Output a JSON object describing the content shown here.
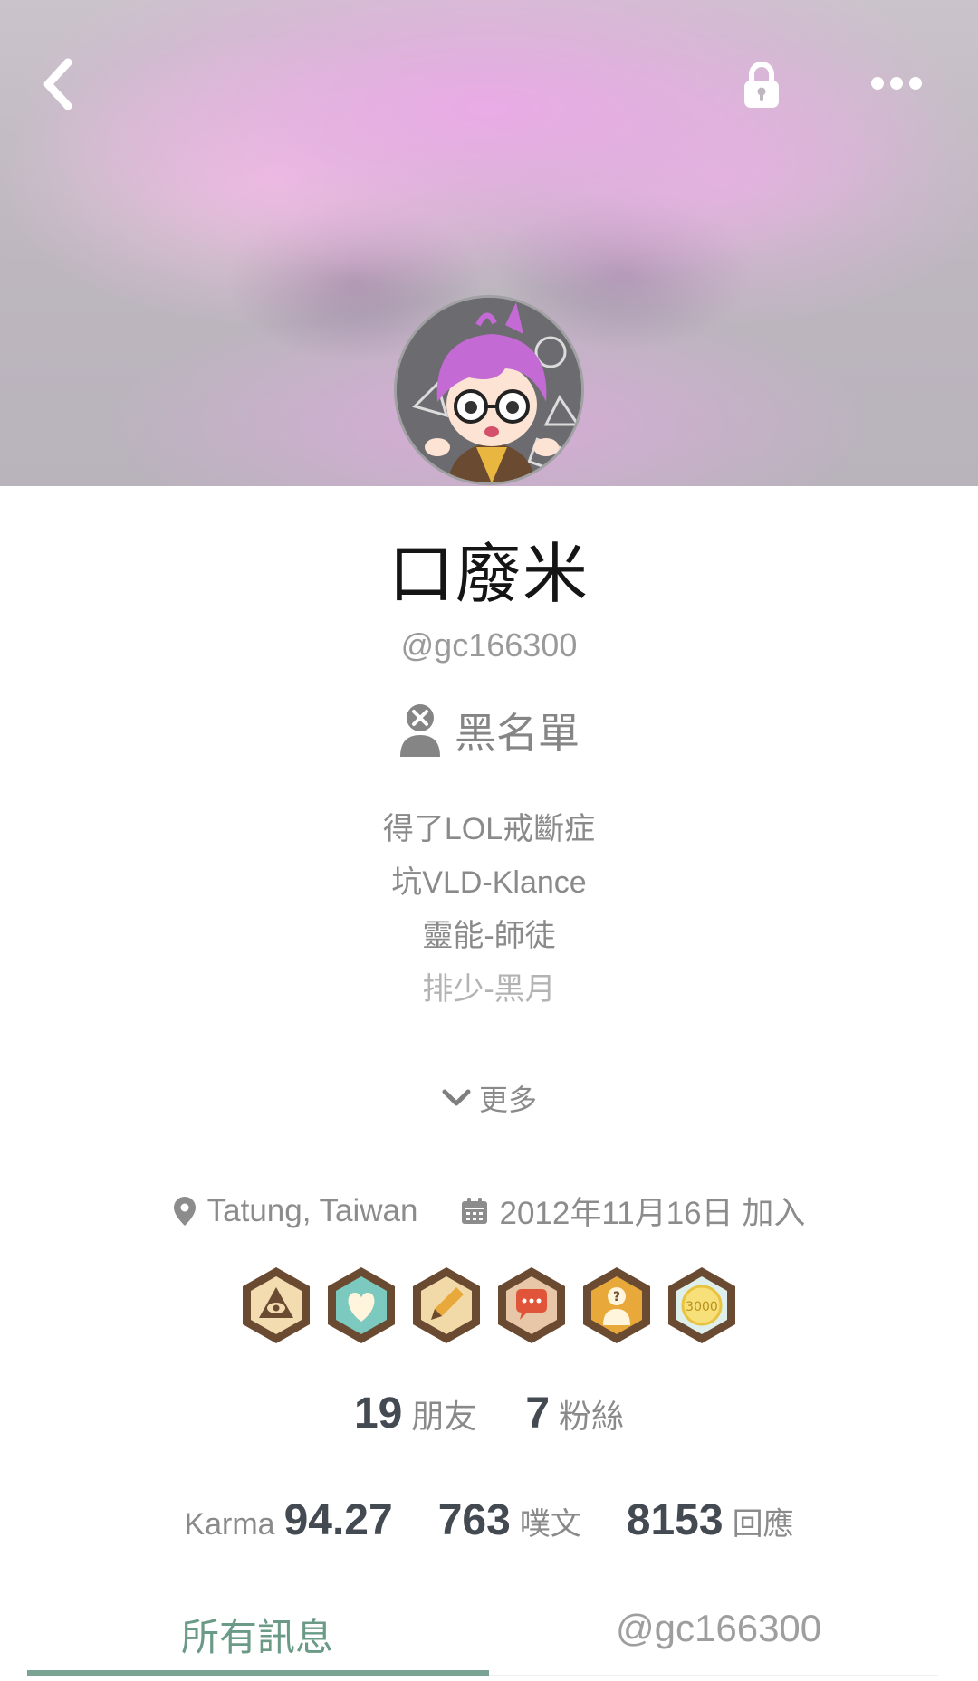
{
  "header": {
    "back_icon": "chevron-left-icon",
    "lock_icon": "lock-icon",
    "more_icon": "more-dots-icon",
    "colors": {
      "banner_pink": "#ecaae8",
      "banner_gray": "#bdb6bf"
    }
  },
  "profile": {
    "display_name": "口廢米",
    "handle": "@gc166300",
    "blacklist_label": "黑名單",
    "blacklist_icon": "user-blocked-icon",
    "bio": [
      "得了LOL戒斷症",
      "坑VLD-Klance",
      "靈能-師徒",
      "排少-黑月"
    ],
    "more_label": "更多",
    "location": "Tatung, Taiwan",
    "joined": "2012年11月16日 加入"
  },
  "badges": [
    {
      "name": "eye-triangle-badge",
      "color": "#f3ddb0"
    },
    {
      "name": "heart-badge",
      "color": "#7cc9bf"
    },
    {
      "name": "pencil-badge",
      "color": "#f1d9a8"
    },
    {
      "name": "chat-badge",
      "color": "#e8c7a8"
    },
    {
      "name": "person-question-badge",
      "color": "#f3ddb0"
    },
    {
      "name": "3000-badge",
      "color": "#f7f0d8",
      "text": "3000"
    }
  ],
  "stats": {
    "friends_count": "19",
    "friends_label": "朋友",
    "fans_count": "7",
    "fans_label": "粉絲",
    "karma_label": "Karma",
    "karma_value": "94.27",
    "plurks_count": "763",
    "plurks_label": "噗文",
    "responses_count": "8153",
    "responses_label": "回應"
  },
  "tabs": [
    {
      "label": "所有訊息",
      "active": true
    },
    {
      "label": "@gc166300",
      "active": false
    }
  ],
  "accent": "#7aa394"
}
